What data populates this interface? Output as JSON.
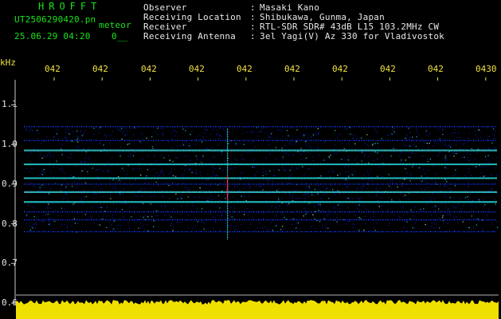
{
  "header": {
    "app_title": "HROFFT",
    "filename": "UT2506290420.pn",
    "event_type": "meteor",
    "datetime": "25.06.29 04:20",
    "counter": "0__"
  },
  "info": [
    {
      "label": "Observer",
      "value": "Masaki Kano"
    },
    {
      "label": "Receiving Location",
      "value": "Shibukawa, Gunma, Japan"
    },
    {
      "label": "Receiver",
      "value": "RTL-SDR SDR# 43dB L15 103.2MHz CW"
    },
    {
      "label": "Receiving Antenna",
      "value": "3el Yagi(V) Az 330 for Vladivostok"
    }
  ],
  "colors": {
    "text": "#e8e8e8",
    "accent_green": "#19e319",
    "tick_yellow": "#f0e040",
    "background": "#000000",
    "waterfall_low": "#0a1aa8",
    "waterfall_mid": "#22c8e0",
    "waterfall_high": "#f03050",
    "power_fill": "#f0e000"
  },
  "chart_data": {
    "type": "heatmap",
    "title": "",
    "xlabel": "",
    "ylabel": "kHz",
    "x_tick_labels": [
      "042",
      "042",
      "042",
      "042",
      "042",
      "042",
      "042",
      "042",
      "042",
      "0430"
    ],
    "y_tick_labels": [
      "1.1",
      "1.0",
      "0.9",
      "0.8",
      "0.7",
      "0.6"
    ],
    "y_ticks": [
      1.1,
      1.0,
      0.9,
      0.8,
      0.7,
      0.6
    ],
    "ylim": [
      0.6,
      1.15
    ],
    "signal_band_khz": [
      0.78,
      1.045
    ],
    "strong_carriers_khz": [
      0.985,
      0.95,
      0.915,
      0.88,
      0.855
    ],
    "weak_carriers_khz": [
      1.045,
      1.01,
      0.9,
      0.83,
      0.81,
      0.78
    ],
    "meteor_echo": {
      "x_fraction": 0.43,
      "khz_range": [
        0.76,
        1.04
      ]
    },
    "grid": false,
    "power_strip": "bottom"
  }
}
